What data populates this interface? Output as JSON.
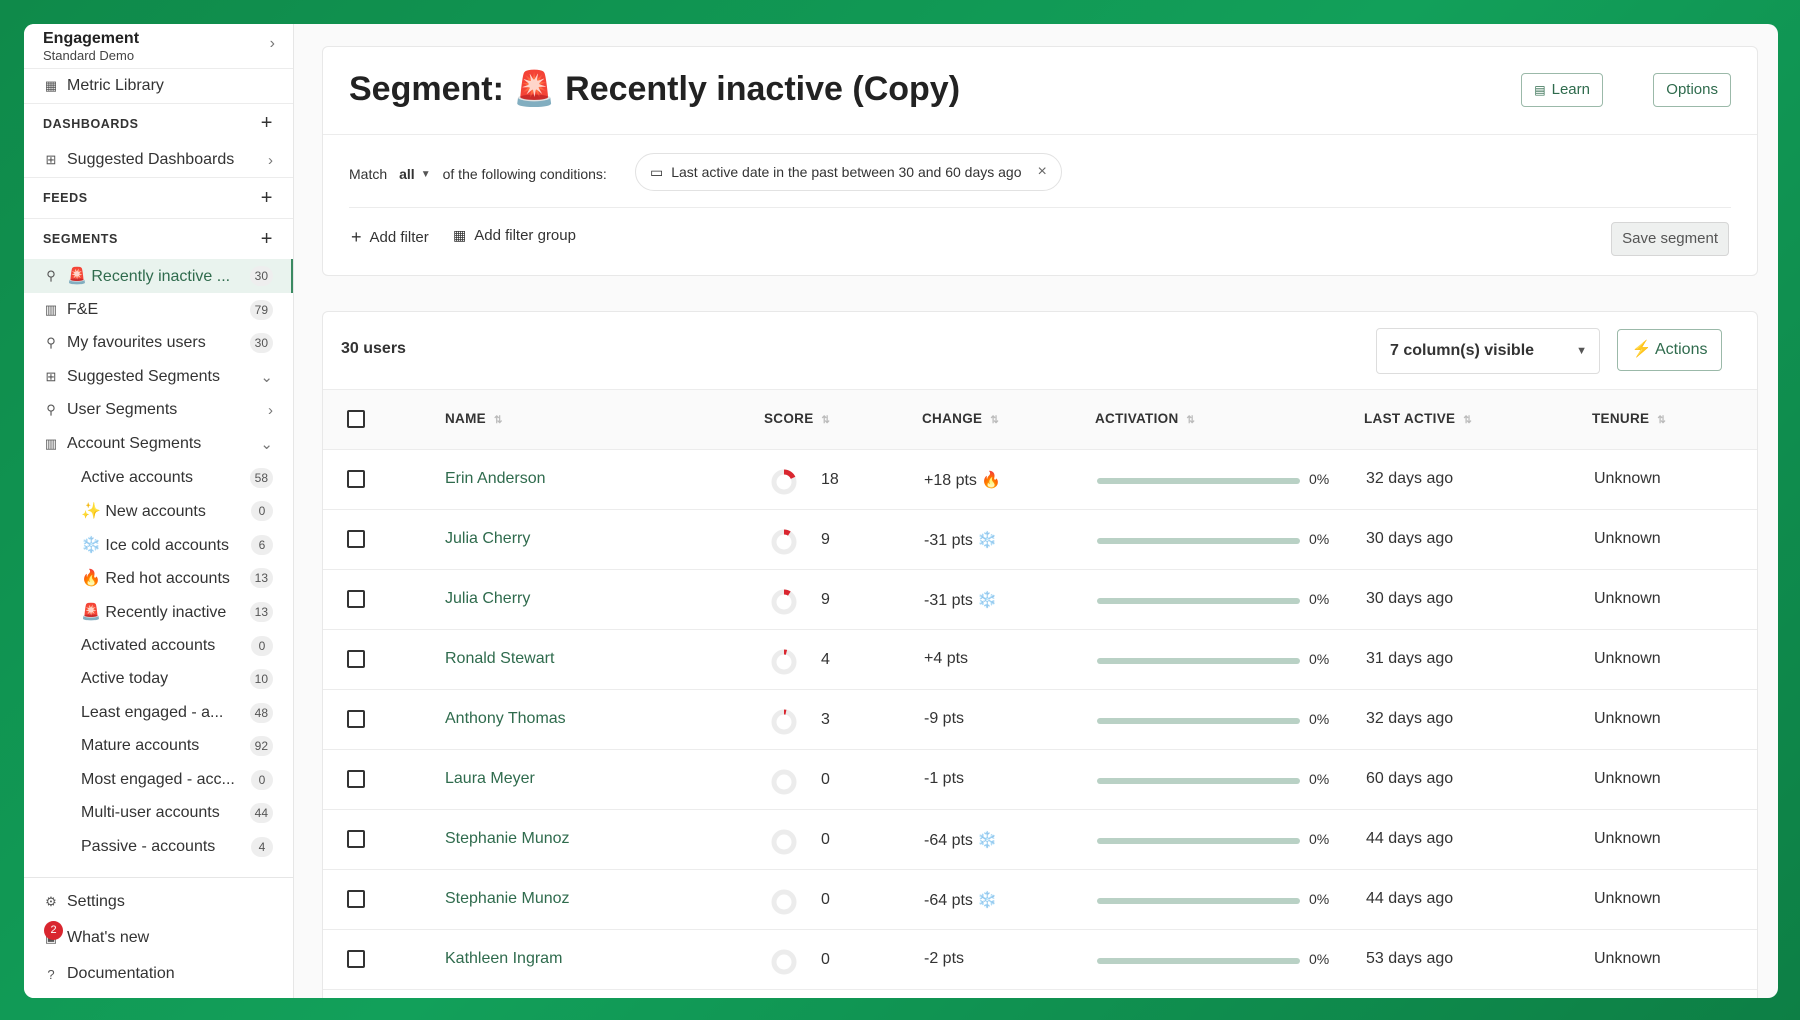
{
  "sidebar": {
    "workspace": {
      "title": "Engagement",
      "subtitle": "Standard Demo"
    },
    "metric_library": "Metric Library",
    "dashboards": {
      "header": "DASHBOARDS",
      "items": [
        {
          "label": "Suggested Dashboards"
        }
      ]
    },
    "feeds": {
      "header": "FEEDS"
    },
    "segments": {
      "header": "SEGMENTS",
      "items": [
        {
          "label": "🚨 Recently inactive ...",
          "count": "30"
        },
        {
          "label": "F&E",
          "count": "79"
        },
        {
          "label": "My favourites users",
          "count": "30"
        },
        {
          "label": "Suggested Segments"
        },
        {
          "label": "User Segments"
        },
        {
          "label": "Account Segments"
        }
      ],
      "account_segments": [
        {
          "label": "Active accounts",
          "count": "58"
        },
        {
          "label": "✨ New accounts",
          "count": "0"
        },
        {
          "label": "❄️ Ice cold accounts",
          "count": "6"
        },
        {
          "label": "🔥 Red hot accounts",
          "count": "13"
        },
        {
          "label": "🚨 Recently inactive",
          "count": "13"
        },
        {
          "label": "Activated accounts",
          "count": "0"
        },
        {
          "label": "Active today",
          "count": "10"
        },
        {
          "label": "Least engaged - a...",
          "count": "48"
        },
        {
          "label": "Mature accounts",
          "count": "92"
        },
        {
          "label": "Most engaged - acc...",
          "count": "0"
        },
        {
          "label": "Multi-user accounts",
          "count": "44"
        },
        {
          "label": "Passive - accounts",
          "count": "4"
        }
      ]
    },
    "bottom": {
      "settings": "Settings",
      "whats_new": "What's new",
      "whats_new_badge": "2",
      "documentation": "Documentation"
    }
  },
  "segment": {
    "title": "Segment: 🚨 Recently inactive (Copy)",
    "learn": "Learn",
    "options": "Options",
    "match_label": "Match",
    "match_value": "all",
    "conditions_text": "of the following conditions:",
    "condition": "Last active date in the past between 30 and 60 days ago",
    "add_filter": "Add filter",
    "add_filter_group": "Add filter group",
    "save": "Save segment"
  },
  "table": {
    "count": "30 users",
    "columns_visible": "7 column(s) visible",
    "actions": "⚡ Actions",
    "headers": {
      "name": "NAME",
      "score": "SCORE",
      "change": "CHANGE",
      "activation": "ACTIVATION",
      "last_active": "LAST ACTIVE",
      "tenure": "TENURE"
    },
    "rows": [
      {
        "name": "Erin Anderson",
        "score": "18",
        "score_frac": 0.18,
        "change": "+18 pts 🔥",
        "activation": "0%",
        "activation_frac": 0,
        "last_active": "32 days ago",
        "tenure": "Unknown"
      },
      {
        "name": "Julia Cherry",
        "score": "9",
        "score_frac": 0.09,
        "change": "-31 pts ❄️",
        "activation": "0%",
        "activation_frac": 0,
        "last_active": "30 days ago",
        "tenure": "Unknown"
      },
      {
        "name": "Julia Cherry",
        "score": "9",
        "score_frac": 0.09,
        "change": "-31 pts ❄️",
        "activation": "0%",
        "activation_frac": 0,
        "last_active": "30 days ago",
        "tenure": "Unknown"
      },
      {
        "name": "Ronald Stewart",
        "score": "4",
        "score_frac": 0.04,
        "change": "+4 pts",
        "activation": "0%",
        "activation_frac": 0,
        "last_active": "31 days ago",
        "tenure": "Unknown"
      },
      {
        "name": "Anthony Thomas",
        "score": "3",
        "score_frac": 0.03,
        "change": "-9 pts",
        "activation": "0%",
        "activation_frac": 0,
        "last_active": "32 days ago",
        "tenure": "Unknown"
      },
      {
        "name": "Laura Meyer",
        "score": "0",
        "score_frac": 0,
        "change": "-1 pts",
        "activation": "0%",
        "activation_frac": 0,
        "last_active": "60 days ago",
        "tenure": "Unknown"
      },
      {
        "name": "Stephanie Munoz",
        "score": "0",
        "score_frac": 0,
        "change": "-64 pts ❄️",
        "activation": "0%",
        "activation_frac": 0,
        "last_active": "44 days ago",
        "tenure": "Unknown"
      },
      {
        "name": "Stephanie Munoz",
        "score": "0",
        "score_frac": 0,
        "change": "-64 pts ❄️",
        "activation": "0%",
        "activation_frac": 0,
        "last_active": "44 days ago",
        "tenure": "Unknown"
      },
      {
        "name": "Kathleen Ingram",
        "score": "0",
        "score_frac": 0,
        "change": "-2 pts",
        "activation": "0%",
        "activation_frac": 0,
        "last_active": "53 days ago",
        "tenure": "Unknown"
      }
    ]
  },
  "colors": {
    "brand": "#2f6b4d",
    "accent_bg": "#e9f3ee",
    "frame": "#12a05a",
    "score_ring": "#d9262f"
  },
  "icons": {
    "grid": "grid-icon",
    "plus": "plus-icon",
    "dashboard": "dashboard-icon",
    "user": "user-icon",
    "building": "building-icon",
    "gear": "gear-icon",
    "gift": "gift-icon",
    "help": "help-icon",
    "calendar": "calendar-icon",
    "close": "close-icon",
    "book": "book-icon",
    "group": "filter-group-icon"
  }
}
